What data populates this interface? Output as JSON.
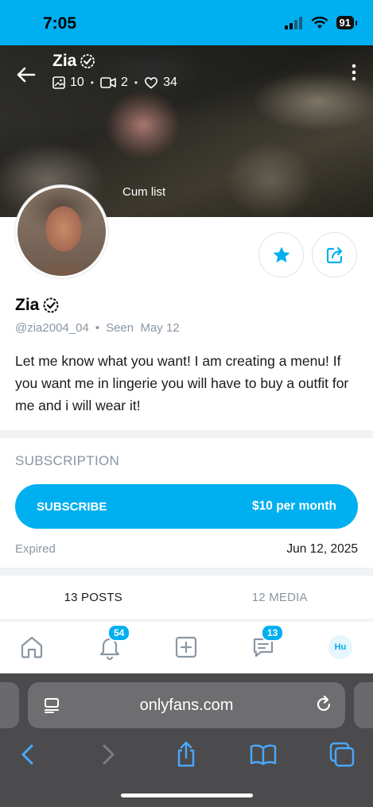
{
  "status_bar": {
    "time": "7:05",
    "battery": "91"
  },
  "cover": {
    "name": "Zia",
    "stats": {
      "photos": "10",
      "videos": "2",
      "likes": "34"
    },
    "caption": "Cum list"
  },
  "profile": {
    "name": "Zia",
    "handle": "@zia2004_04",
    "seen": "Seen  May 12",
    "bio": "Let me know what you want! I am creating a menu! If you want me in lingerie you will have to buy a outfit for me and i will wear it!"
  },
  "subscription": {
    "heading": "SUBSCRIPTION",
    "button_label": "SUBSCRIBE",
    "price": "$10 per month",
    "status": "Expired",
    "date": "Jun 12, 2025"
  },
  "tabs": [
    {
      "label": "13 POSTS"
    },
    {
      "label": "12 MEDIA"
    }
  ],
  "bottom_nav": {
    "notifications_badge": "54",
    "messages_badge": "13",
    "user_initials": "Hu"
  },
  "browser": {
    "url": "onlyfans.com"
  },
  "colors": {
    "accent": "#00aff0",
    "muted": "#8a96a3",
    "browser_bg": "#4b4b4d",
    "browser_icon": "#4aa8ff"
  },
  "icons": [
    "back-arrow-icon",
    "verified-icon",
    "image-icon",
    "video-icon",
    "heart-icon",
    "more-vertical-icon",
    "star-icon",
    "share-icon",
    "home-icon",
    "bell-icon",
    "add-post-icon",
    "messages-icon",
    "reader-icon",
    "reload-icon",
    "chevron-left-icon",
    "chevron-right-icon",
    "share-sheet-icon",
    "bookmarks-icon",
    "tabs-icon"
  ]
}
